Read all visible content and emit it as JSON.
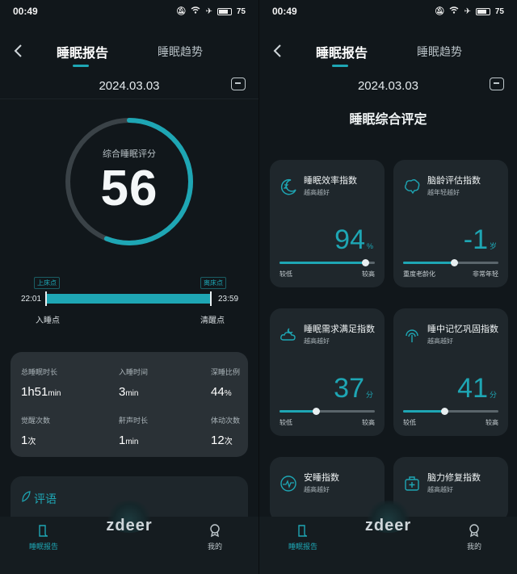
{
  "status": {
    "time": "00:49",
    "battery": "75"
  },
  "nav": {
    "tab_report": "睡眠报告",
    "tab_trend": "睡眠趋势"
  },
  "date": "2024.03.03",
  "left": {
    "score_label": "综合睡眠评分",
    "score": "56",
    "score_fraction": 0.56,
    "timeline": {
      "bed_flag": "上床点",
      "rise_flag": "离床点",
      "start_time": "22:01",
      "end_time": "23:59",
      "start_label": "入睡点",
      "end_label": "清醒点"
    },
    "stats": [
      {
        "label": "总睡眠时长",
        "value": "1h51",
        "unit": "min"
      },
      {
        "label": "入睡时间",
        "value": "3",
        "unit": "min"
      },
      {
        "label": "深睡比例",
        "value": "44",
        "unit": "%"
      },
      {
        "label": "觉醒次数",
        "value": "1",
        "unit": "次"
      },
      {
        "label": "鼾声时长",
        "value": "1",
        "unit": "min"
      },
      {
        "label": "体动次数",
        "value": "12",
        "unit": "次"
      }
    ],
    "comment_title": "评语"
  },
  "right": {
    "section_title": "睡眠综合评定",
    "cards": [
      {
        "name": "睡眠效率指数",
        "sub": "越高越好",
        "value": "94",
        "unit": "%",
        "lo": "较低",
        "hi": "较高",
        "level": 0.9,
        "icon": "moon-zzz-icon"
      },
      {
        "name": "脑龄评估指数",
        "sub": "越年轻越好",
        "value": "-1",
        "unit": "岁",
        "lo": "重度老龄化",
        "hi": "非常年轻",
        "level": 0.53,
        "icon": "brain-icon"
      },
      {
        "name": "睡眠需求满足指数",
        "sub": "越高越好",
        "value": "37",
        "unit": "分",
        "lo": "较低",
        "hi": "较高",
        "level": 0.38,
        "icon": "cloud-moon-icon"
      },
      {
        "name": "睡中记忆巩固指数",
        "sub": "越高越好",
        "value": "41",
        "unit": "分",
        "lo": "较低",
        "hi": "较高",
        "level": 0.43,
        "icon": "memory-icon"
      },
      {
        "name": "安睡指数",
        "sub": "越高越好",
        "icon": "wave-icon"
      },
      {
        "name": "脑力修复指数",
        "sub": "越高越好",
        "icon": "repair-kit-icon"
      }
    ]
  },
  "bottom": {
    "report": "睡眠报告",
    "mine": "我的",
    "watermark": "zdeer"
  },
  "colors": {
    "accent": "#1ea6b4",
    "card": "#1f272c",
    "bg": "#11171b"
  }
}
